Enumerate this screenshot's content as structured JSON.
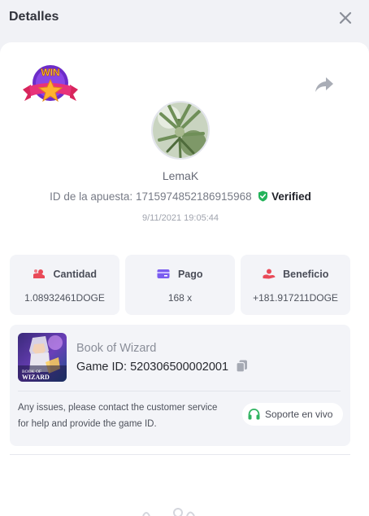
{
  "header": {
    "title": "Detalles",
    "close_icon": "close-icon"
  },
  "badge": {
    "text": "WIN",
    "icon": "win-star-badge-icon"
  },
  "share": {
    "icon": "share-arrow-icon"
  },
  "player": {
    "username": "LemaK",
    "bet_id_label": "ID de la apuesta:",
    "bet_id": "1715974852186915968",
    "verified_label": "Verified",
    "timestamp": "9/11/2021 19:05:44"
  },
  "stats": [
    {
      "label": "Cantidad",
      "value": "1.08932461DOGE",
      "icon": "coin-pile-icon"
    },
    {
      "label": "Pago",
      "value": "168 x",
      "icon": "card-icon"
    },
    {
      "label": "Beneficio",
      "value": "+181.917211DOGE",
      "icon": "hand-coins-icon"
    }
  ],
  "game": {
    "name": "Book of Wizard",
    "id_label": "Game ID:",
    "id": "520306500002001",
    "thumb_line1": "BOOK OF",
    "thumb_line2": "WIZARD",
    "copy_icon": "copy-icon"
  },
  "support": {
    "message": "Any issues, please contact the customer service for help and provide the game ID.",
    "button_label": "Soporte en vivo",
    "icon": "headset-icon"
  },
  "colors": {
    "background": "#f1f2f6",
    "panel": "#ffffff",
    "card": "#f3f4f8",
    "verified": "#23b35a",
    "cantidad_icon": "#e94a58",
    "pago_icon": "#7a5cf0",
    "beneficio_icon": "#e94a58",
    "support_icon": "#2fb360"
  }
}
